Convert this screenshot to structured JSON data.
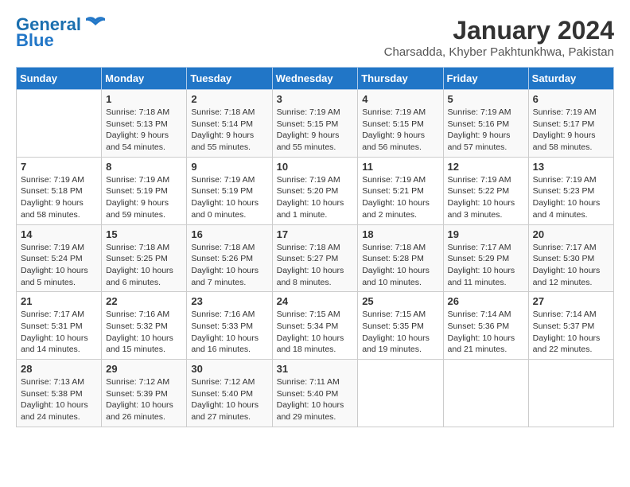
{
  "header": {
    "logo_line1": "General",
    "logo_line2": "Blue",
    "month_year": "January 2024",
    "location": "Charsadda, Khyber Pakhtunkhwa, Pakistan"
  },
  "weekdays": [
    "Sunday",
    "Monday",
    "Tuesday",
    "Wednesday",
    "Thursday",
    "Friday",
    "Saturday"
  ],
  "weeks": [
    [
      {
        "day": "",
        "sunrise": "",
        "sunset": "",
        "daylight": ""
      },
      {
        "day": "1",
        "sunrise": "7:18 AM",
        "sunset": "5:13 PM",
        "daylight": "9 hours and 54 minutes."
      },
      {
        "day": "2",
        "sunrise": "7:18 AM",
        "sunset": "5:14 PM",
        "daylight": "9 hours and 55 minutes."
      },
      {
        "day": "3",
        "sunrise": "7:19 AM",
        "sunset": "5:15 PM",
        "daylight": "9 hours and 55 minutes."
      },
      {
        "day": "4",
        "sunrise": "7:19 AM",
        "sunset": "5:15 PM",
        "daylight": "9 hours and 56 minutes."
      },
      {
        "day": "5",
        "sunrise": "7:19 AM",
        "sunset": "5:16 PM",
        "daylight": "9 hours and 57 minutes."
      },
      {
        "day": "6",
        "sunrise": "7:19 AM",
        "sunset": "5:17 PM",
        "daylight": "9 hours and 58 minutes."
      }
    ],
    [
      {
        "day": "7",
        "sunrise": "7:19 AM",
        "sunset": "5:18 PM",
        "daylight": "9 hours and 58 minutes."
      },
      {
        "day": "8",
        "sunrise": "7:19 AM",
        "sunset": "5:19 PM",
        "daylight": "9 hours and 59 minutes."
      },
      {
        "day": "9",
        "sunrise": "7:19 AM",
        "sunset": "5:19 PM",
        "daylight": "10 hours and 0 minutes."
      },
      {
        "day": "10",
        "sunrise": "7:19 AM",
        "sunset": "5:20 PM",
        "daylight": "10 hours and 1 minute."
      },
      {
        "day": "11",
        "sunrise": "7:19 AM",
        "sunset": "5:21 PM",
        "daylight": "10 hours and 2 minutes."
      },
      {
        "day": "12",
        "sunrise": "7:19 AM",
        "sunset": "5:22 PM",
        "daylight": "10 hours and 3 minutes."
      },
      {
        "day": "13",
        "sunrise": "7:19 AM",
        "sunset": "5:23 PM",
        "daylight": "10 hours and 4 minutes."
      }
    ],
    [
      {
        "day": "14",
        "sunrise": "7:19 AM",
        "sunset": "5:24 PM",
        "daylight": "10 hours and 5 minutes."
      },
      {
        "day": "15",
        "sunrise": "7:18 AM",
        "sunset": "5:25 PM",
        "daylight": "10 hours and 6 minutes."
      },
      {
        "day": "16",
        "sunrise": "7:18 AM",
        "sunset": "5:26 PM",
        "daylight": "10 hours and 7 minutes."
      },
      {
        "day": "17",
        "sunrise": "7:18 AM",
        "sunset": "5:27 PM",
        "daylight": "10 hours and 8 minutes."
      },
      {
        "day": "18",
        "sunrise": "7:18 AM",
        "sunset": "5:28 PM",
        "daylight": "10 hours and 10 minutes."
      },
      {
        "day": "19",
        "sunrise": "7:17 AM",
        "sunset": "5:29 PM",
        "daylight": "10 hours and 11 minutes."
      },
      {
        "day": "20",
        "sunrise": "7:17 AM",
        "sunset": "5:30 PM",
        "daylight": "10 hours and 12 minutes."
      }
    ],
    [
      {
        "day": "21",
        "sunrise": "7:17 AM",
        "sunset": "5:31 PM",
        "daylight": "10 hours and 14 minutes."
      },
      {
        "day": "22",
        "sunrise": "7:16 AM",
        "sunset": "5:32 PM",
        "daylight": "10 hours and 15 minutes."
      },
      {
        "day": "23",
        "sunrise": "7:16 AM",
        "sunset": "5:33 PM",
        "daylight": "10 hours and 16 minutes."
      },
      {
        "day": "24",
        "sunrise": "7:15 AM",
        "sunset": "5:34 PM",
        "daylight": "10 hours and 18 minutes."
      },
      {
        "day": "25",
        "sunrise": "7:15 AM",
        "sunset": "5:35 PM",
        "daylight": "10 hours and 19 minutes."
      },
      {
        "day": "26",
        "sunrise": "7:14 AM",
        "sunset": "5:36 PM",
        "daylight": "10 hours and 21 minutes."
      },
      {
        "day": "27",
        "sunrise": "7:14 AM",
        "sunset": "5:37 PM",
        "daylight": "10 hours and 22 minutes."
      }
    ],
    [
      {
        "day": "28",
        "sunrise": "7:13 AM",
        "sunset": "5:38 PM",
        "daylight": "10 hours and 24 minutes."
      },
      {
        "day": "29",
        "sunrise": "7:12 AM",
        "sunset": "5:39 PM",
        "daylight": "10 hours and 26 minutes."
      },
      {
        "day": "30",
        "sunrise": "7:12 AM",
        "sunset": "5:40 PM",
        "daylight": "10 hours and 27 minutes."
      },
      {
        "day": "31",
        "sunrise": "7:11 AM",
        "sunset": "5:40 PM",
        "daylight": "10 hours and 29 minutes."
      },
      {
        "day": "",
        "sunrise": "",
        "sunset": "",
        "daylight": ""
      },
      {
        "day": "",
        "sunrise": "",
        "sunset": "",
        "daylight": ""
      },
      {
        "day": "",
        "sunrise": "",
        "sunset": "",
        "daylight": ""
      }
    ]
  ]
}
